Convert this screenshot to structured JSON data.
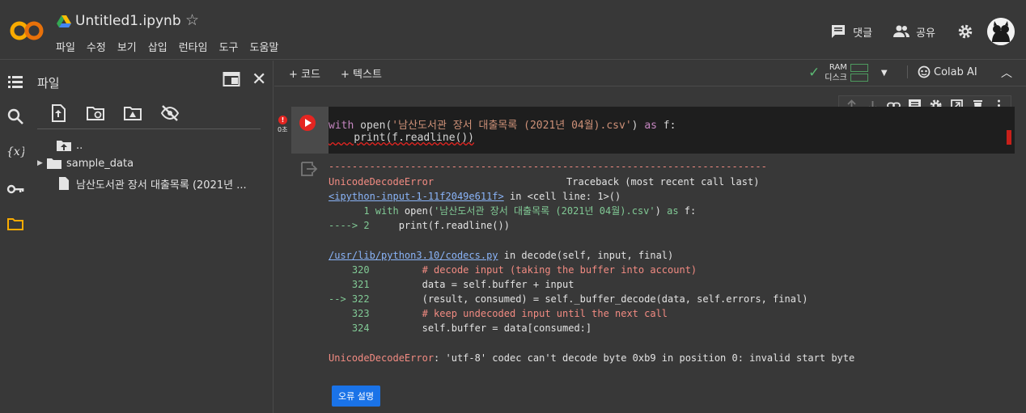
{
  "header": {
    "logo_text": "CO",
    "notebook_title": "Untitled1.ipynb",
    "star_icon": "star-outline-icon",
    "menus": [
      "파일",
      "수정",
      "보기",
      "삽입",
      "런타임",
      "도구",
      "도움말"
    ],
    "comments_label": "댓글",
    "share_label": "공유"
  },
  "sidebar": {
    "title": "파일",
    "tree": [
      {
        "label": "..",
        "type": "folder-up"
      },
      {
        "label": "sample_data",
        "type": "folder"
      },
      {
        "label": "남산도서관 장서 대출목록 (2021년 ...",
        "type": "file"
      }
    ]
  },
  "toolbar": {
    "add_code": "+ 코드",
    "add_text": "+ 텍스트",
    "ram_label": "RAM",
    "disk_label": "디스크",
    "colab_ai": "Colab AI"
  },
  "cell": {
    "exec_time": "0초",
    "code_line1_a": "with",
    "code_line1_b": " open(",
    "code_line1_c": "'남산도서관 장서 대출목록 (2021년 04월).csv'",
    "code_line1_d": ") ",
    "code_line1_e": "as",
    "code_line1_f": " f:",
    "code_line2": "    print(f.readline())"
  },
  "output": {
    "dashes": "---------------------------------------------------------------------------",
    "err_name": "UnicodeDecodeError",
    "traceback_label": "Traceback (most recent call last)",
    "link1": "<ipython-input-1-11f2049e611f>",
    "link1_suffix": " in <cell line: 1>()",
    "l1_num": "      1 ",
    "l1_kw": "with",
    "l1_a": " open(",
    "l1_str": "'남산도서관 장서 대출목록 (2021년 04월).csv'",
    "l1_b": ") ",
    "l1_kw2": "as",
    "l1_c": " f:",
    "l2_arrow": "----> 2",
    "l2_code": "     print(f.readline())",
    "link2": "/usr/lib/python3.10/codecs.py",
    "link2_suffix": " in decode(self, input, final)",
    "l320_num": "    320",
    "l320_code": "         # decode input (taking the buffer into account)",
    "l321_num": "    321",
    "l321_code": "         data = self.buffer + input",
    "l322_arrow": "--> 322",
    "l322_code": "         (result, consumed) = self._buffer_decode(data, self.errors, final)",
    "l323_num": "    323",
    "l323_code": "         # keep undecoded input until the next call",
    "l324_num": "    324",
    "l324_code": "         self.buffer = data[consumed:]",
    "final_name": "UnicodeDecodeError",
    "final_msg": ": 'utf-8' codec can't decode byte 0xb9 in position 0: invalid start byte",
    "explain_button": "오류 설명"
  }
}
